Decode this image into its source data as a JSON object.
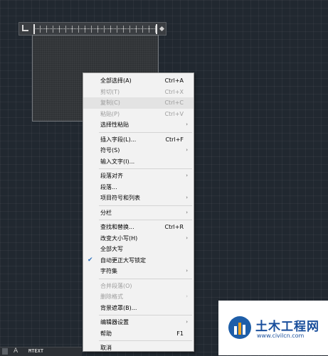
{
  "menu": {
    "items": [
      {
        "label": "全部选择(A)",
        "shortcut": "Ctrl+A"
      },
      {
        "label": "剪切(T)",
        "shortcut": "Ctrl+X",
        "disabled": true
      },
      {
        "label": "复制(C)",
        "shortcut": "Ctrl+C",
        "disabled": true
      },
      {
        "label": "粘贴(P)",
        "shortcut": "Ctrl+V",
        "disabled": true
      },
      {
        "label": "选择性粘贴",
        "submenu": true
      },
      {
        "separator": true
      },
      {
        "label": "插入字段(L)...",
        "shortcut": "Ctrl+F"
      },
      {
        "label": "符号(S)",
        "submenu": true
      },
      {
        "label": "输入文字(I)..."
      },
      {
        "separator": true
      },
      {
        "label": "段落对齐",
        "submenu": true
      },
      {
        "label": "段落..."
      },
      {
        "label": "项目符号和列表",
        "submenu": true
      },
      {
        "separator": true
      },
      {
        "label": "分栏",
        "submenu": true
      },
      {
        "separator": true
      },
      {
        "label": "查找和替换...",
        "shortcut": "Ctrl+R"
      },
      {
        "label": "改变大小写(H)",
        "submenu": true
      },
      {
        "label": "全部大写"
      },
      {
        "label": "自动更正大写锁定",
        "checked": true
      },
      {
        "label": "字符集",
        "submenu": true
      },
      {
        "separator": true
      },
      {
        "label": "合并段落(O)",
        "disabled": true
      },
      {
        "label": "删除格式",
        "submenu": true,
        "disabled": true
      },
      {
        "label": "背景遮罩(B)..."
      },
      {
        "separator": true
      },
      {
        "label": "编辑器设置",
        "submenu": true
      },
      {
        "label": "帮助",
        "shortcut": "F1"
      },
      {
        "separator": true
      },
      {
        "label": "取消"
      }
    ],
    "arrow_glyph": "›",
    "check_glyph": "✔"
  },
  "statusbar": {
    "command_icon": "A",
    "command_text": "MTEXT"
  },
  "watermark": {
    "brand": "土木工程网",
    "url": "www.civilcn.com"
  },
  "colors": {
    "canvas": "#212830",
    "menu_bg": "#f2f2f2",
    "check": "#2a6fbd",
    "brand": "#1a4f9c"
  }
}
